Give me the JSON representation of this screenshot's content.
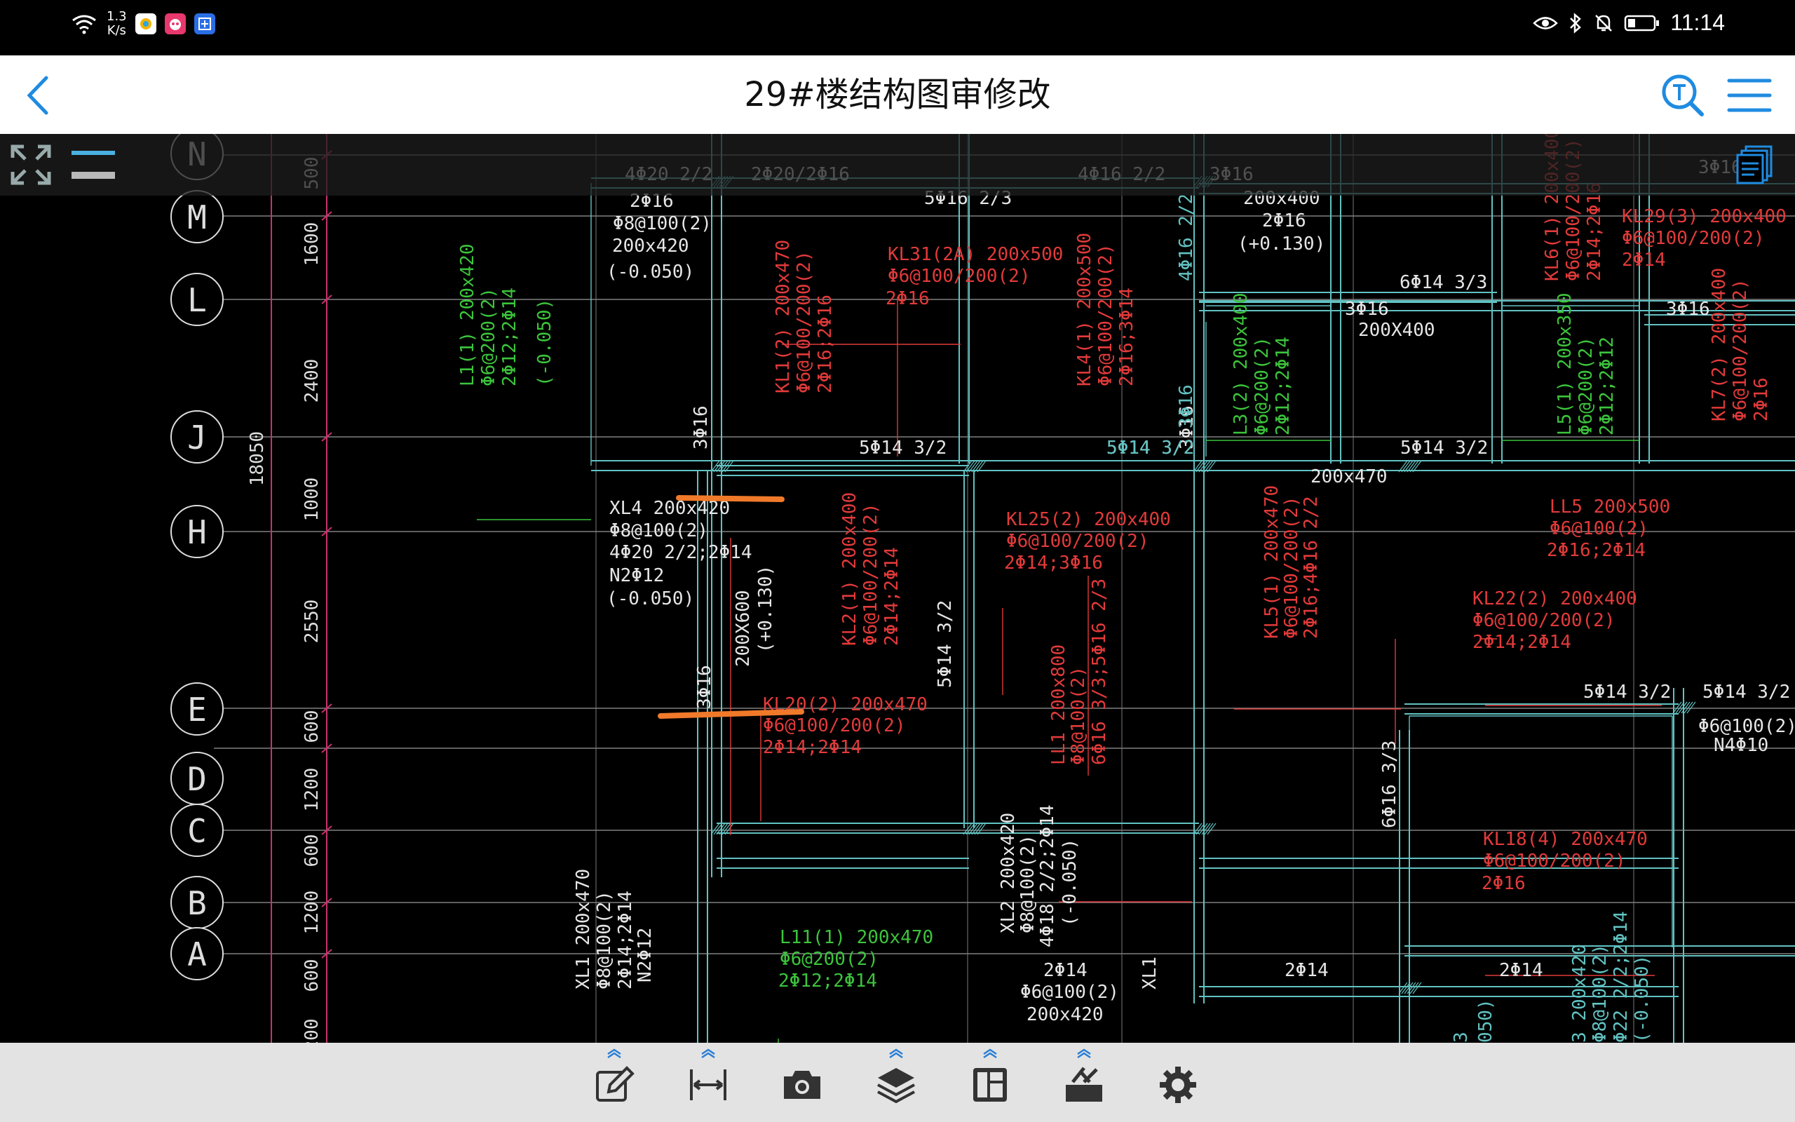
{
  "status_bar": {
    "net_speed_value": "1.3",
    "net_speed_unit": "K/s",
    "time": "11:14"
  },
  "header": {
    "title": "29#楼结构图审修改"
  },
  "drawing": {
    "axes": [
      "N",
      "M",
      "L",
      "J",
      "H",
      "E",
      "D",
      "C",
      "B",
      "A"
    ],
    "dims": [
      "500",
      "1600",
      "2400",
      "18050",
      "1000",
      "2550",
      "600",
      "1200",
      "600",
      "1200",
      "600",
      "200"
    ],
    "labels_white": [
      "4Φ20 2/2",
      "2Φ20/2Φ16",
      "4Φ16 2/2",
      "3Φ16",
      "5Φ16 2/3",
      "2Φ16",
      "Φ8@100(2)",
      "200x420",
      "(-0.050)",
      "200x400",
      "2Φ16",
      "(+0.130)",
      "6Φ14 3/3",
      "3Φ16",
      "200X400",
      "3Φ16",
      "3Φ16",
      "5Φ14 3/2",
      "5Φ14 3/2",
      "5Φ14 3/2",
      "3Φ16",
      "3Φ16",
      "XL4 200x420",
      "Φ8@100(2)",
      "4Φ20 2/2;2Φ14",
      "N2Φ12",
      "(-0.050)",
      "200X600",
      "(+0.130)",
      "200x470",
      "5Φ14 3/2",
      "3Φ16",
      "5Φ14 3/2",
      "5Φ14 3/2",
      "Φ6@100(2)",
      "N4Φ10",
      "XL1 200x470",
      "Φ8@100(2)",
      "2Φ14;2Φ14",
      "N2Φ12",
      "XL2 200x420",
      "Φ8@100(2)",
      "4Φ18 2/2;2Φ14",
      "(-0.050)",
      "2Φ14",
      "Φ6@100(2)",
      "200x420",
      "XL1",
      "2Φ14",
      "2Φ14",
      "6Φ16 3/3"
    ],
    "labels_red": [
      "KL31(2A) 200x500",
      "Φ6@100/200(2)",
      "2Φ16",
      "KL1(2) 200x470",
      "Φ6@100/200(2)",
      "2Φ16;2Φ16",
      "KL4(1) 200x500",
      "Φ6@100/200(2)",
      "2Φ16;3Φ14",
      "KL25(2) 200x400",
      "Φ6@100/200(2)",
      "2Φ14;3Φ16",
      "KL2(1) 200x400",
      "Φ6@100/200(2)",
      "2Φ14;2Φ14",
      "KL20(2) 200x470",
      "Φ6@100/200(2)",
      "2Φ14;2Φ14",
      "LL1 200x800",
      "Φ8@100(2)",
      "6Φ16 3/3;5Φ16 2/3",
      "KL5(1) 200x470",
      "Φ6@100/200(2)",
      "2Φ16;4Φ16 2/2",
      "LL5 200x500",
      "Φ6@100(2)",
      "2Φ16;2Φ14",
      "KL22(2) 200x400",
      "Φ6@100/200(2)",
      "2Φ14;2Φ14",
      "KL18(4) 200x470",
      "Φ6@100/200(2)",
      "2Φ16",
      "KL29(3) 200x400",
      "Φ6@100/200(2)",
      "2Φ14",
      "KL6(1) 200x400",
      "Φ6@100/200(2)",
      "2Φ14;2Φ16",
      "KL7(2) 200x400",
      "Φ6@100/200(2)",
      "2Φ16"
    ],
    "labels_green": [
      "L1(1) 200x420",
      "Φ6@200(2)",
      "2Φ12;2Φ14",
      "(-0.050)",
      "L3(2) 200x400",
      "Φ6@200(2)",
      "2Φ12;2Φ14",
      "L5(1) 200x350",
      "Φ6@200(2)",
      "2Φ12;2Φ12",
      "L11(1) 200x470",
      "Φ6@200(2)",
      "2Φ12;2Φ14"
    ],
    "labels_misc": [
      "4Φ16 2/2",
      "5Φ14 3/2",
      "3Φ16",
      "050)",
      "3",
      "3 200x420",
      "Φ8@100(2)",
      "Φ22 2/2;2Φ14",
      "(-0.050)"
    ]
  },
  "toolbar": {
    "tools": [
      "annotate",
      "measure",
      "camera",
      "layers",
      "layout",
      "toolbox",
      "settings"
    ]
  },
  "colors": {
    "cad_white": "#e6e6e6",
    "cad_red": "#e23a3a",
    "cad_green": "#3cc43c",
    "cad_cyan": "#62c2c2",
    "cad_magenta": "#c8326e",
    "markup_orange": "#f07a2a",
    "accent_blue": "#1f8be0"
  }
}
